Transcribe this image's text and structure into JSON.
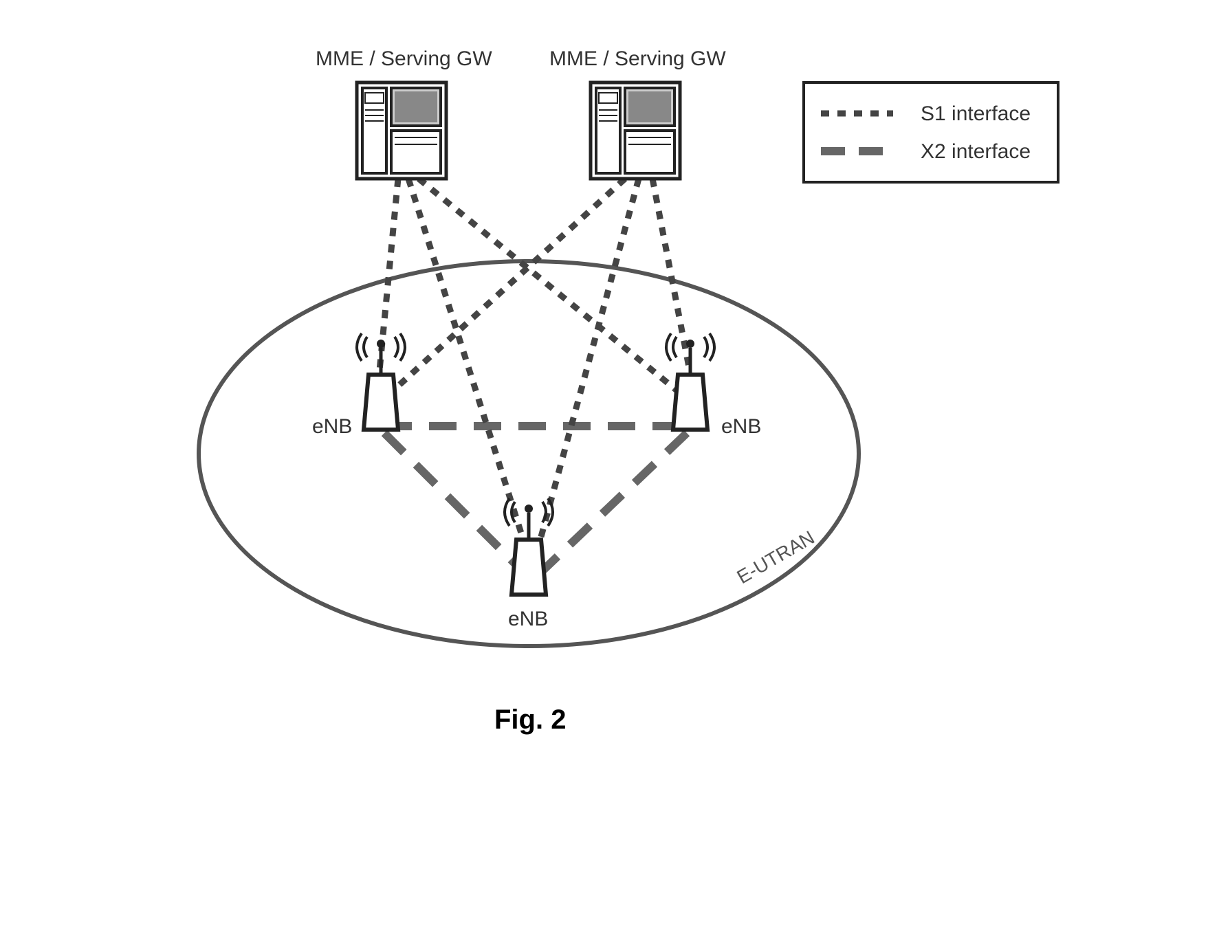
{
  "labels": {
    "server_left": "MME / Serving GW",
    "server_right": "MME / Serving GW",
    "enb_left": "eNB",
    "enb_right": "eNB",
    "enb_bottom": "eNB",
    "cloud": "E-UTRAN",
    "legend_s1": "S1 interface",
    "legend_x2": "X2 interface",
    "figure": "Fig. 2"
  },
  "chart_data": {
    "type": "network-diagram",
    "nodes": [
      {
        "id": "mme1",
        "type": "MME/Serving-GW",
        "label": "MME / Serving GW"
      },
      {
        "id": "mme2",
        "type": "MME/Serving-GW",
        "label": "MME / Serving GW"
      },
      {
        "id": "enb1",
        "type": "eNB",
        "label": "eNB"
      },
      {
        "id": "enb2",
        "type": "eNB",
        "label": "eNB"
      },
      {
        "id": "enb3",
        "type": "eNB",
        "label": "eNB"
      }
    ],
    "edges": [
      {
        "from": "mme1",
        "to": "enb1",
        "interface": "S1"
      },
      {
        "from": "mme1",
        "to": "enb2",
        "interface": "S1"
      },
      {
        "from": "mme1",
        "to": "enb3",
        "interface": "S1"
      },
      {
        "from": "mme2",
        "to": "enb1",
        "interface": "S1"
      },
      {
        "from": "mme2",
        "to": "enb2",
        "interface": "S1"
      },
      {
        "from": "mme2",
        "to": "enb3",
        "interface": "S1"
      },
      {
        "from": "enb1",
        "to": "enb2",
        "interface": "X2"
      },
      {
        "from": "enb1",
        "to": "enb3",
        "interface": "X2"
      },
      {
        "from": "enb2",
        "to": "enb3",
        "interface": "X2"
      }
    ],
    "region": "E-UTRAN",
    "title": "Fig. 2"
  }
}
